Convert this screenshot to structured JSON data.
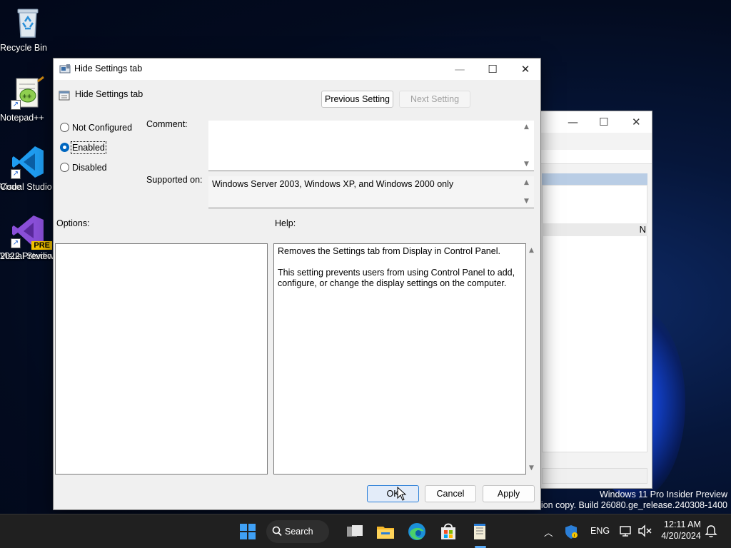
{
  "desktop": {
    "icons": [
      {
        "label": "Recycle Bin",
        "icon": "recycle-bin-icon"
      },
      {
        "label": "Notepad++",
        "icon": "notepad-plus-plus-icon"
      },
      {
        "label": "Visual Studio Code",
        "line1": "Visual Studio",
        "line2": "Code",
        "icon": "vscode-icon"
      },
      {
        "label": "Visual Studio 2022 Preview",
        "line1": "Visual Studio",
        "line2": "2022 Preview",
        "icon": "visual-studio-preview-icon",
        "badge": "PRE"
      }
    ],
    "watermark": {
      "line1": "Windows 11 Pro Insider Preview",
      "line2": "Evaluation copy. Build 26080.ge_release.240308-1400"
    }
  },
  "background_window": {
    "row_letter": "N"
  },
  "dialog": {
    "title": "Hide Settings tab",
    "setting_name": "Hide Settings tab",
    "buttons": {
      "previous": "Previous Setting",
      "next": "Next Setting",
      "ok": "OK",
      "cancel": "Cancel",
      "apply": "Apply"
    },
    "radios": [
      {
        "label": "Not Configured",
        "checked": false
      },
      {
        "label": "Enabled",
        "checked": true
      },
      {
        "label": "Disabled",
        "checked": false
      }
    ],
    "comment_label": "Comment:",
    "comment_value": "",
    "supported_label": "Supported on:",
    "supported_value": "Windows Server 2003, Windows XP, and Windows 2000 only",
    "options_label": "Options:",
    "help_label": "Help:",
    "help_text": "Removes the Settings tab from Display in Control Panel.\n\nThis setting prevents users from using Control Panel to add, configure, or change the display settings on the computer."
  },
  "taskbar": {
    "search_label": "Search",
    "language": "ENG",
    "time": "12:11 AM",
    "date": "4/20/2024",
    "pinned": [
      "start-icon",
      "task-view-icon",
      "file-explorer-icon",
      "edge-icon",
      "store-icon",
      "notepad-icon"
    ]
  },
  "colors": {
    "accent": "#0067c0",
    "taskbar": "#202020",
    "dialog_bg": "#f0f0f0"
  }
}
